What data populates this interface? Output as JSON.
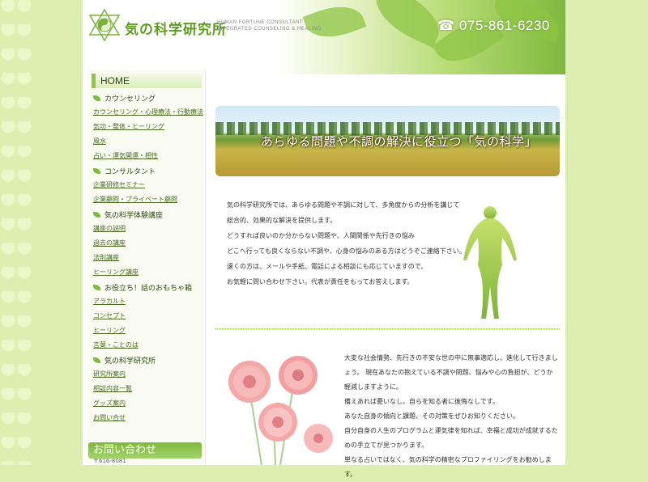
{
  "header": {
    "site_title": "気の科学研究所",
    "tagline_line1": "HUMAN FORTUNE CONSULTANT",
    "tagline_line2": "INTEGRATED COUNSELING & HEALING",
    "phone": "075-861-6230"
  },
  "sidebar": {
    "home": "HOME",
    "sections": [
      {
        "title": "カウンセリング",
        "links": [
          "カウンセリング・心理療法・行動療法",
          "気功・整体・ヒーリング",
          "風水",
          "占い・運気開運・相性"
        ]
      },
      {
        "title": "コンサルタント",
        "links": [
          "企業研修セミナー",
          "企業顧問・プライベート顧問"
        ]
      },
      {
        "title": "気の科学体験講座",
        "links": [
          "講座の説明",
          "過去の講座",
          "法則講座",
          "ヒーリング講座"
        ]
      },
      {
        "title": "お役立ち！話のおもちゃ箱",
        "links": [
          "アラカルト",
          "コンセプト",
          "ヒーリング",
          "言葉・ことのは"
        ]
      },
      {
        "title": "気の科学研究所",
        "links": [
          "研究所案内",
          "相談内容一覧",
          "グッズ案内",
          "お問い合せ"
        ]
      }
    ],
    "contact_banner": "お問い合わせ",
    "contact_sub": "〒616-8081"
  },
  "main": {
    "banner_caption": "あらゆる問題や不調の解決に役立つ「気の科学」",
    "intro": [
      "気の科学研究所では、あらゆる問題や不調に対して、多角度からの分析を講じて",
      "総合的、効果的な解決を提供します。",
      "どうすれば良いのか分からない問題や、人間関係や先行きの悩み",
      "どこへ行っても良くならない不調や、心身の悩みのある方はどうぞご連絡下さい。",
      "遠くの方は、メールや手紙、電話による相談にも応じていますので、",
      "お気軽に問い合わせ下さい。代表が責任をもってお答えします。"
    ],
    "body": [
      "大変な社会情勢、先行きの不安な世の中に無事適応し、進化して行きましょう。 現在あなたの抱えている不調や問題、悩みや心の負担が、どうか軽減しますように。",
      "備えあれば憂いなし。自らを知る者に後悔なしです。",
      "あなた自身の傾向と課題、その対策をぜひお知りください。",
      "自分自身の人生のプログラムと運気律を知れば、幸福と成功が成就するための手立てが見つかります。",
      "単なる占いではなく、気の科学の精密なプロファイリングをお勧めします。"
    ]
  },
  "colors": {
    "accent": "#8ec742",
    "background": "#dcefb0",
    "nav_text": "#4a6b20"
  }
}
